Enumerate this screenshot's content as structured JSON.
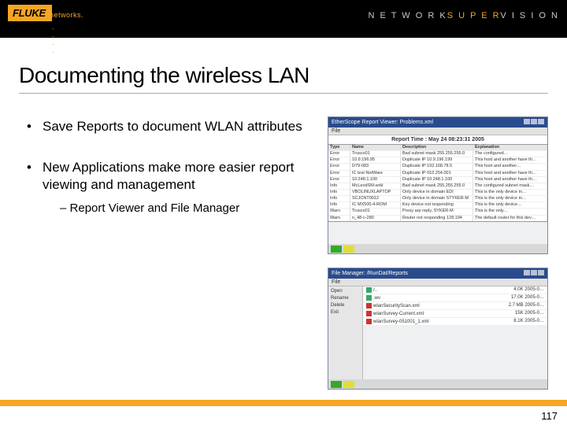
{
  "header": {
    "logo_text": "FLUKE",
    "logo_sub": "networks.",
    "dots": ". . . .",
    "right_prefix": "N E T W O R K",
    "right_em": "S U P E R",
    "right_suffix": "V I S I O N"
  },
  "title": "Documenting the wireless LAN",
  "bullets": {
    "b1": "Save Reports to document WLAN attributes",
    "b2": "New  Applications make more easier report viewing and management",
    "b2_sub": "Report Viewer and File Manager"
  },
  "report_viewer": {
    "window_title": "EtherScope Report Viewer: Problems.xml",
    "menu": "File",
    "report_time": "Report Time : May 24 08:23:31 2005",
    "headers": {
      "c1": "Type",
      "c2": "Name",
      "c3": "Description",
      "c4": "Explanation"
    },
    "rows": [
      {
        "c1": "Error",
        "c2": "Trusco01",
        "c3": "Bad subnet mask 255.255.255.0",
        "c4": "The configured…"
      },
      {
        "c1": "Error",
        "c2": "10.9.196.95",
        "c3": "Duplicate IP 10.9.196.199",
        "c4": "This host and another have th…"
      },
      {
        "c1": "Error",
        "c2": "D79-083",
        "c3": "Duplicate IP 192.168.78.5",
        "c4": "This host and another…"
      },
      {
        "c1": "Error",
        "c2": "IC test NetWare",
        "c3": "Duplicate IP 010.254.001",
        "c4": "This host and another have th…"
      },
      {
        "c1": "Error",
        "c2": "10.248.1.100",
        "c3": "Duplicate IP 10.248.1.100",
        "c4": "This host and another have th…"
      },
      {
        "c1": "Info",
        "c2": "McLeodSM-wrkl",
        "c3": "Bad subnet mask 255.255.255.0",
        "c4": "The configured subnet mask…"
      },
      {
        "c1": "Info",
        "c2": "VBOLINUXLAPTOP",
        "c3": "Only device in domain EDI",
        "c4": "This is the only device in…"
      },
      {
        "c1": "Info",
        "c2": "SCJCNT0012",
        "c3": "Only device in domain STYKER-M",
        "c4": "This is the only device in…"
      },
      {
        "c1": "Info",
        "c2": "IC MX500-4-ROM",
        "c3": "Key device not responding",
        "c4": "This is the only device…"
      },
      {
        "c1": "Warn",
        "c2": "Trusco01",
        "c3": "Proxy arp reply, SYKER-M",
        "c4": "This is the only…"
      },
      {
        "c1": "Warn",
        "c2": "n_48-c-280",
        "c3": "Router not responding 128.194",
        "c4": "The default router for this dev…"
      }
    ]
  },
  "file_manager": {
    "window_title": "File Manager: /RunDat/Reports",
    "menu": "File",
    "side": [
      "Open",
      "Rename",
      "Delete",
      "Exit"
    ],
    "files": [
      {
        "name": "/..",
        "meta": "4.0K 2005-0…",
        "cls": "f"
      },
      {
        "name": ".wv",
        "meta": "17.0K 2005-0…",
        "cls": "f"
      },
      {
        "name": "wlanSecurityScan.xml",
        "meta": "2.7 MB 2005-0…",
        "cls": ""
      },
      {
        "name": "wlanSurvey-Current.xml",
        "meta": "15K 2005-0…",
        "cls": ""
      },
      {
        "name": "wlanSurvey-051001_1.xml",
        "meta": "8.1K 2005-0…",
        "cls": ""
      }
    ]
  },
  "page_number": "117"
}
